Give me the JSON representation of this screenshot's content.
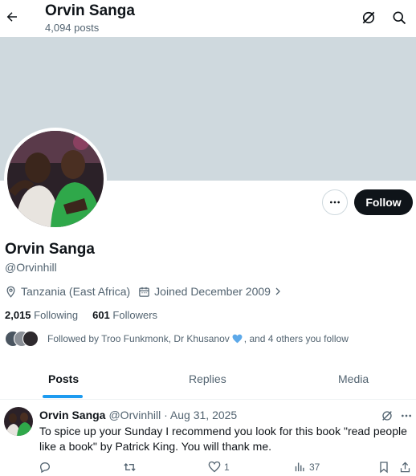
{
  "header": {
    "title": "Orvin Sanga",
    "post_count": "4,094 posts",
    "icons": [
      "back-arrow-icon",
      "grok-icon",
      "search-icon"
    ]
  },
  "profile": {
    "name": "Orvin Sanga",
    "handle": "@Orvinhill",
    "location": "Tanzania (East Africa)",
    "joined": "Joined December 2009",
    "following_count": "2,015",
    "following_label": "Following",
    "followers_count": "601",
    "followers_label": "Followers",
    "followed_by_prefix": "Followed by Troo Funkmonk, Dr Khusanov",
    "followed_by_suffix": ", and 4 others you follow"
  },
  "actions": {
    "follow_label": "Follow"
  },
  "tabs": [
    {
      "label": "Posts",
      "active": true
    },
    {
      "label": "Replies",
      "active": false
    },
    {
      "label": "Media",
      "active": false
    }
  ],
  "post": {
    "author": "Orvin Sanga",
    "meta": "@Orvinhill · Aug 31, 2025",
    "text": "To spice up your Sunday I recommend you look for this book \"read people like a book\" by Patrick King. You will thank me.",
    "likes": "1",
    "views": "37"
  },
  "colors": {
    "accent": "#1d9bf0",
    "banner": "#cfd9de",
    "text_primary": "#0f1419",
    "text_secondary": "#536471",
    "follow_button": "#0f1419"
  }
}
